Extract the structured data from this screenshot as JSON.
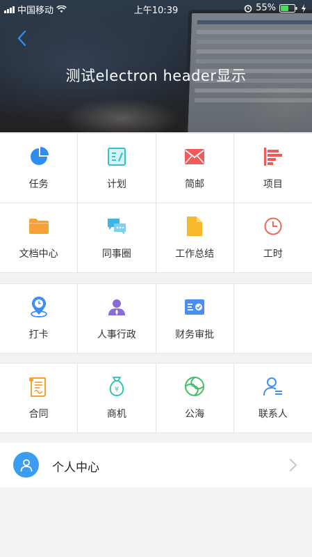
{
  "status_bar": {
    "carrier": "中国移动",
    "time": "上午10:39",
    "battery": "55%"
  },
  "header": {
    "title": "测试electron header显示",
    "back_icon": "chevron-left-icon"
  },
  "groups": [
    {
      "items": [
        {
          "label": "任务",
          "icon": "pie-chart-icon",
          "color": "#2f8cf0"
        },
        {
          "label": "计划",
          "icon": "plan-edit-icon",
          "color": "#2ec5c9"
        },
        {
          "label": "简邮",
          "icon": "mail-icon",
          "color": "#f25a5a"
        },
        {
          "label": "项目",
          "icon": "project-bars-icon",
          "color": "#f25a5a"
        },
        {
          "label": "文档中心",
          "icon": "folder-icon",
          "color": "#f7a035"
        },
        {
          "label": "同事圈",
          "icon": "chat-bubbles-icon",
          "color": "#3bb6e8"
        },
        {
          "label": "工作总结",
          "icon": "document-icon",
          "color": "#f6b92b"
        },
        {
          "label": "工时",
          "icon": "clock-icon",
          "color": "#f0645a"
        }
      ]
    },
    {
      "items": [
        {
          "label": "打卡",
          "icon": "location-clock-icon",
          "color": "#3b8ff0"
        },
        {
          "label": "人事行政",
          "icon": "person-icon",
          "color": "#8a6bd8"
        },
        {
          "label": "财务审批",
          "icon": "finance-card-icon",
          "color": "#4a8ef0"
        }
      ]
    },
    {
      "items": [
        {
          "label": "合同",
          "icon": "contract-scroll-icon",
          "color": "#f7a035"
        },
        {
          "label": "商机",
          "icon": "money-bag-icon",
          "color": "#2ec5b0"
        },
        {
          "label": "公海",
          "icon": "swirl-icon",
          "color": "#3fbf63"
        },
        {
          "label": "联系人",
          "icon": "contact-icon",
          "color": "#3b8ff0"
        }
      ]
    }
  ],
  "personal_center": {
    "label": "个人中心",
    "icon": "avatar-icon",
    "chevron": "chevron-right-icon"
  }
}
